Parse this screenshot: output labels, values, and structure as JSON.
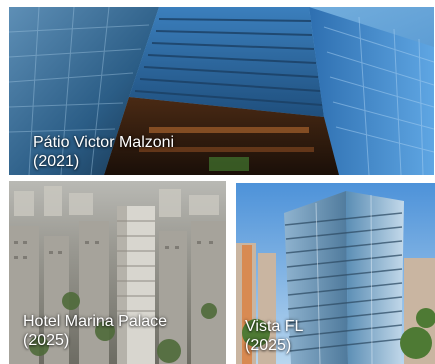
{
  "projects": [
    {
      "name": "Pátio Victor Malzoni",
      "year": "(2021)"
    },
    {
      "name": "Hotel Marina Palace",
      "year": "(2025)"
    },
    {
      "name": "Vista FL",
      "year": "(2025)"
    }
  ]
}
